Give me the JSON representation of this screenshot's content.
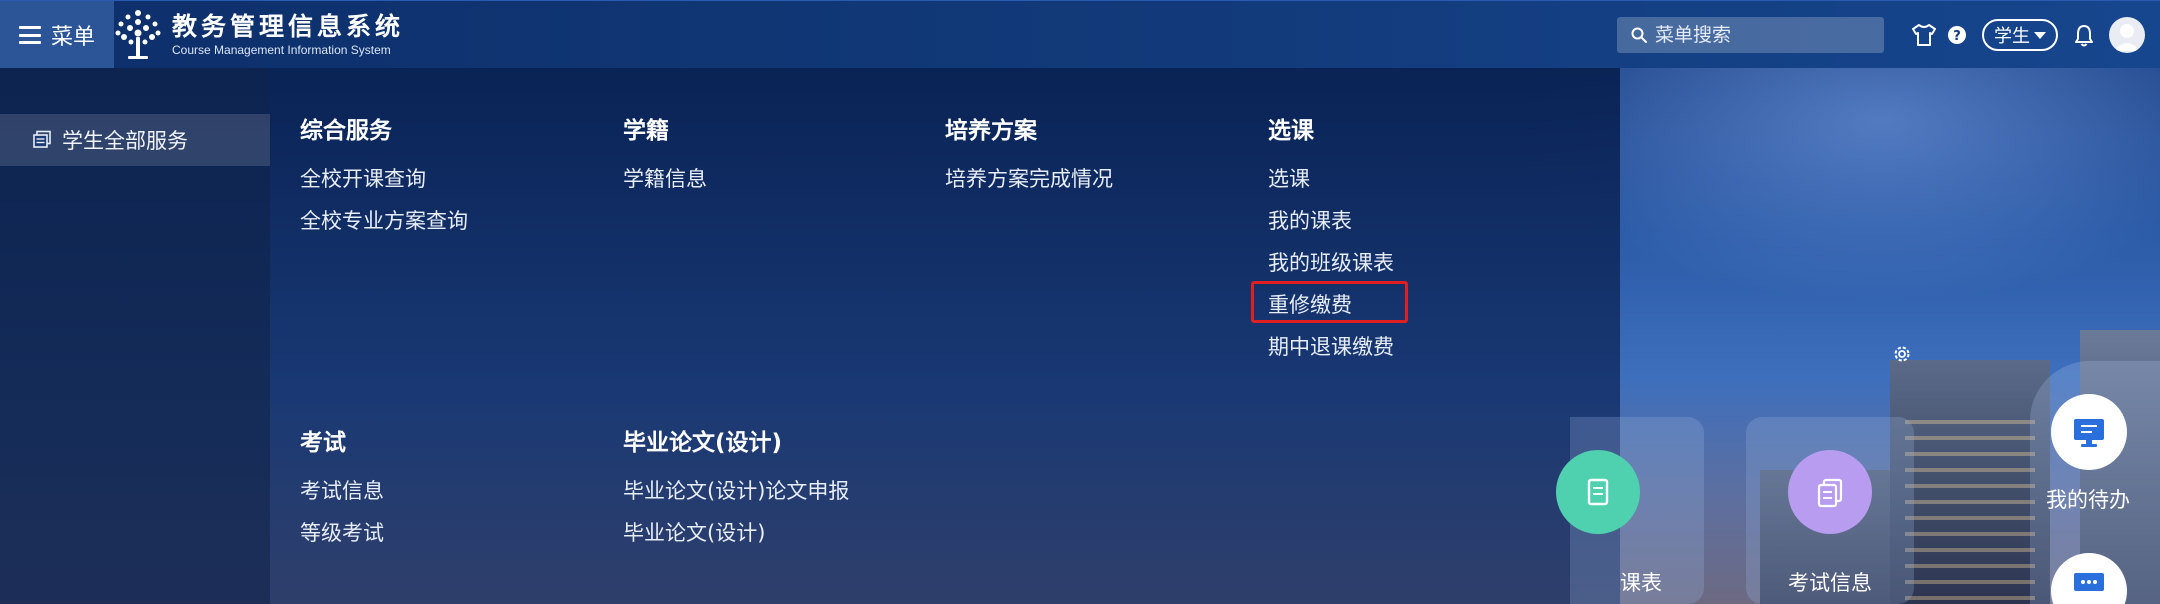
{
  "header": {
    "menu_label": "菜单",
    "logo_title": "教务管理信息系统",
    "logo_subtitle": "Course Management Information System",
    "search_placeholder": "菜单搜索",
    "role": "学生"
  },
  "sidebar": {
    "items": [
      {
        "label": "学生全部服务",
        "icon": "card-stack-icon"
      }
    ]
  },
  "mega_menu": {
    "groups": [
      {
        "title": "综合服务",
        "links": [
          "全校开课查询",
          "全校专业方案查询"
        ]
      },
      {
        "title": "学籍",
        "links": [
          "学籍信息"
        ]
      },
      {
        "title": "培养方案",
        "links": [
          "培养方案完成情况"
        ]
      },
      {
        "title": "选课",
        "links": [
          "选课",
          "我的课表",
          "我的班级课表",
          "重修缴费",
          "期中退课缴费"
        ]
      },
      {
        "title": "考试",
        "links": [
          "考试信息",
          "等级考试"
        ]
      },
      {
        "title": "毕业论文(设计)",
        "links": [
          "毕业论文(设计)论文申报",
          "毕业论文(设计)"
        ]
      }
    ],
    "highlighted_link": "重修缴费"
  },
  "dashboard": {
    "cards": [
      {
        "label": "课表",
        "icon": "document-icon",
        "color": "#4fd1b0"
      },
      {
        "label": "考试信息",
        "icon": "documents-icon",
        "color": "#b79cf0"
      }
    ],
    "todo": {
      "label": "我的待办",
      "icon": "monitor-icon"
    }
  },
  "colors": {
    "header_bg": "#123a7a",
    "menu_toggle_bg": "#2b5597",
    "highlight_border": "#e02020",
    "icon_blue": "#2a6fdb"
  }
}
